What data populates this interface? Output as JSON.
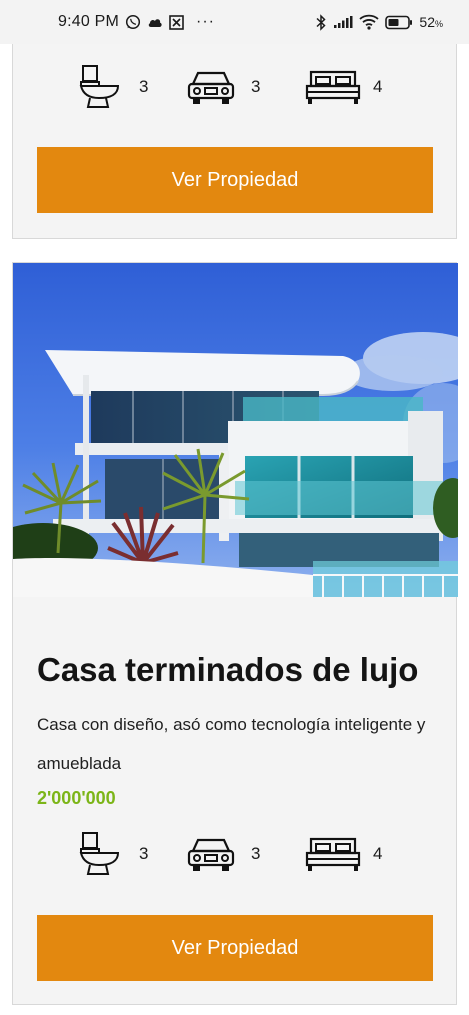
{
  "status_bar": {
    "time": "9:40 PM",
    "overflow_dots": "···",
    "battery_percent": "52",
    "battery_unit": "%"
  },
  "top_card": {
    "bathrooms": "3",
    "parking": "3",
    "bedrooms": "4",
    "button_label": "Ver Propiedad"
  },
  "property_card": {
    "title": "Casa terminados de lujo",
    "description": "Casa con diseño, asó como tecnología inteligente y amueblada",
    "price": "2'000'000",
    "bathrooms": "3",
    "parking": "3",
    "bedrooms": "4",
    "button_label": "Ver Propiedad",
    "price_color": "#7cb518",
    "button_color": "#e3880f"
  }
}
